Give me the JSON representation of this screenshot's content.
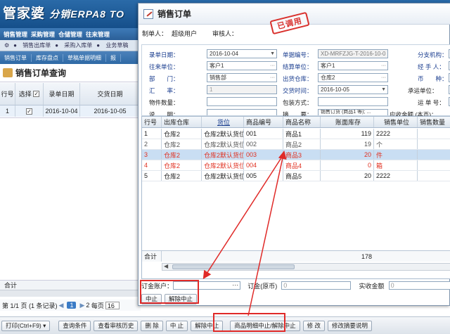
{
  "app": {
    "logo_main": "管家婆",
    "logo_sub": "分销ERPA8 TO"
  },
  "bg_menu": [
    "销售管理",
    "采购管理",
    "仓储管理",
    "往来管理"
  ],
  "bg_sub": [
    "销售出库单",
    "采购入库单",
    "业务草稿"
  ],
  "bg_tabs": [
    "销售订单",
    "库存盘点",
    "草稿单据明细",
    "报"
  ],
  "bg_page": {
    "title": "销售订单查询",
    "columns": [
      "行号",
      "选择",
      "录单日期",
      "交货日期"
    ],
    "row": {
      "no": "1",
      "date": "2016-10-04",
      "delivery": "2016-10-05"
    },
    "sum_label": "合计",
    "pager": {
      "text": "第 1/1 页 (1 条记录)",
      "current": "1",
      "next": "2",
      "per_page_label": "每页",
      "per_page": "16"
    }
  },
  "bottom_toolbar": [
    "打印(Ctrl+F9)",
    "查询条件",
    "查看审核历史",
    "删 除",
    "中 止",
    "解除中止",
    "商品明细中止/解除中止",
    "修 改",
    "修改摘要说明"
  ],
  "dialog": {
    "title": "销售订单",
    "stamp": "已调用",
    "creator_label": "制单人：",
    "creator": "超级用户",
    "auditor_label": "审核人：",
    "auditor": "",
    "form": {
      "entry_date_label": "录单日期：",
      "entry_date": "2016-10-04",
      "doc_no_label": "单据编号：",
      "doc_no": "XD-MRFZJG-T-2016-10-0",
      "branch_label": "分支机构：",
      "partner_label": "往来单位：",
      "partner": "客户1",
      "settle_label": "结算单位：",
      "settle": "客户1",
      "handler_label": "经 手 人：",
      "dept_label": "部　　门：",
      "dept": "销售部",
      "warehouse_label": "出货仓库：",
      "warehouse": "仓库2",
      "currency_label": "币　　种：",
      "rate_label": "汇　　率：",
      "rate": "1",
      "delivery_label": "交货时间：",
      "delivery": "2016-10-05",
      "carrier_label": "承运单位：",
      "items_label": "物件数量：",
      "pack_label": "包装方式：",
      "shipno_label": "运 单 号：",
      "desc_label": "说　　明：",
      "summary_label": "摘　　要：",
      "summary": "销售订货 (商品1 等); ...",
      "amount_label": "应收金额 (本币)："
    },
    "grid": {
      "columns": [
        "行号",
        "出库仓库",
        "货位",
        "商品编号",
        "商品名称",
        "账面库存",
        "销售单位",
        "销售数量"
      ],
      "rows": [
        {
          "no": "1",
          "wh": "仓库2",
          "loc": "仓库2默认货位",
          "code": "001",
          "name": "商品1",
          "stock": "119",
          "unit": "2222",
          "qty": ""
        },
        {
          "no": "2",
          "wh": "仓库2",
          "loc": "仓库2默认货位",
          "code": "002",
          "name": "商品2",
          "stock": "19",
          "unit": "个",
          "qty": ""
        },
        {
          "no": "3",
          "wh": "仓库2",
          "loc": "仓库2默认货位",
          "code": "003",
          "name": "商品3",
          "stock": "20",
          "unit": "件",
          "qty": ""
        },
        {
          "no": "4",
          "wh": "仓库2",
          "loc": "仓库2默认货位",
          "code": "004",
          "name": "商品4",
          "stock": "0",
          "unit": "箱",
          "qty": ""
        },
        {
          "no": "5",
          "wh": "仓库2",
          "loc": "仓库2默认货位",
          "code": "005",
          "name": "商品5",
          "stock": "20",
          "unit": "2222",
          "qty": ""
        }
      ],
      "sum_label": "合计",
      "sum_stock": "178"
    },
    "bottom": {
      "account_label": "订金账户：",
      "deposit_label": "订金(原币)",
      "deposit": "0",
      "received_label": "实收金额",
      "received": "0"
    },
    "buttons": {
      "stop": "中止",
      "unstop": "解除中止"
    }
  },
  "colors": {
    "annotation": "#e02a28",
    "header_blue": "#1d5b9a",
    "row_red": "#e03020",
    "selected_row": "#c9def3"
  }
}
